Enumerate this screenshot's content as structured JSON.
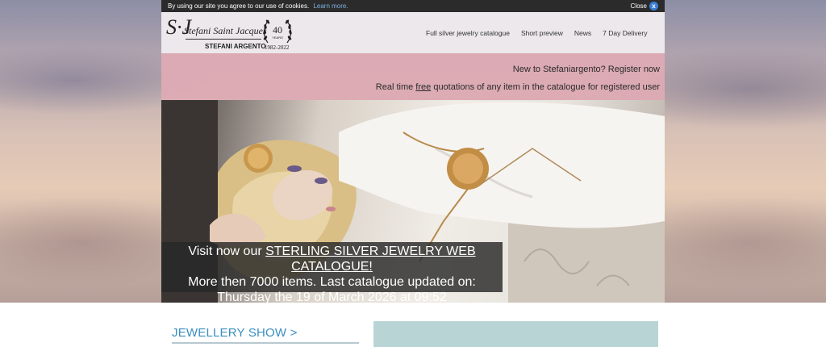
{
  "cookie_bar": {
    "message": "By using our site you agree to our use of cookies.",
    "learn_more": "Learn more.",
    "close_label": "Close",
    "close_icon": "x-icon"
  },
  "logo": {
    "monogram": "S·J",
    "name": "Stefani Saint Jacques",
    "subtitle": "STEFANI ARGENTO",
    "badge_number": "40",
    "badge_small": "YEARS",
    "years": "1982-2022"
  },
  "nav": {
    "items": [
      "Full silver jewelry catalogue",
      "Short preview",
      "News",
      "7 Day Delivery"
    ]
  },
  "banner": {
    "register": "New to Stefaniargento? Register now",
    "quote_prefix": "Real time ",
    "quote_free": "free",
    "quote_suffix": " quotations of any item in the catalogue for registered user"
  },
  "hero": {
    "line1_prefix": "Visit now our ",
    "line1_link": "STERLING SILVER JEWELRY WEB CATALOGUE!",
    "line2": "More then 7000 items. Last catalogue updated on:",
    "line3": "Thursday the 19 of March 2026 at 09:52"
  },
  "section": {
    "jewellery_show": "JEWELLERY SHOW >"
  },
  "colors": {
    "banner_pink": "#deaab4",
    "link_blue": "#3a8fc0",
    "teal": "#b9d4d4"
  }
}
